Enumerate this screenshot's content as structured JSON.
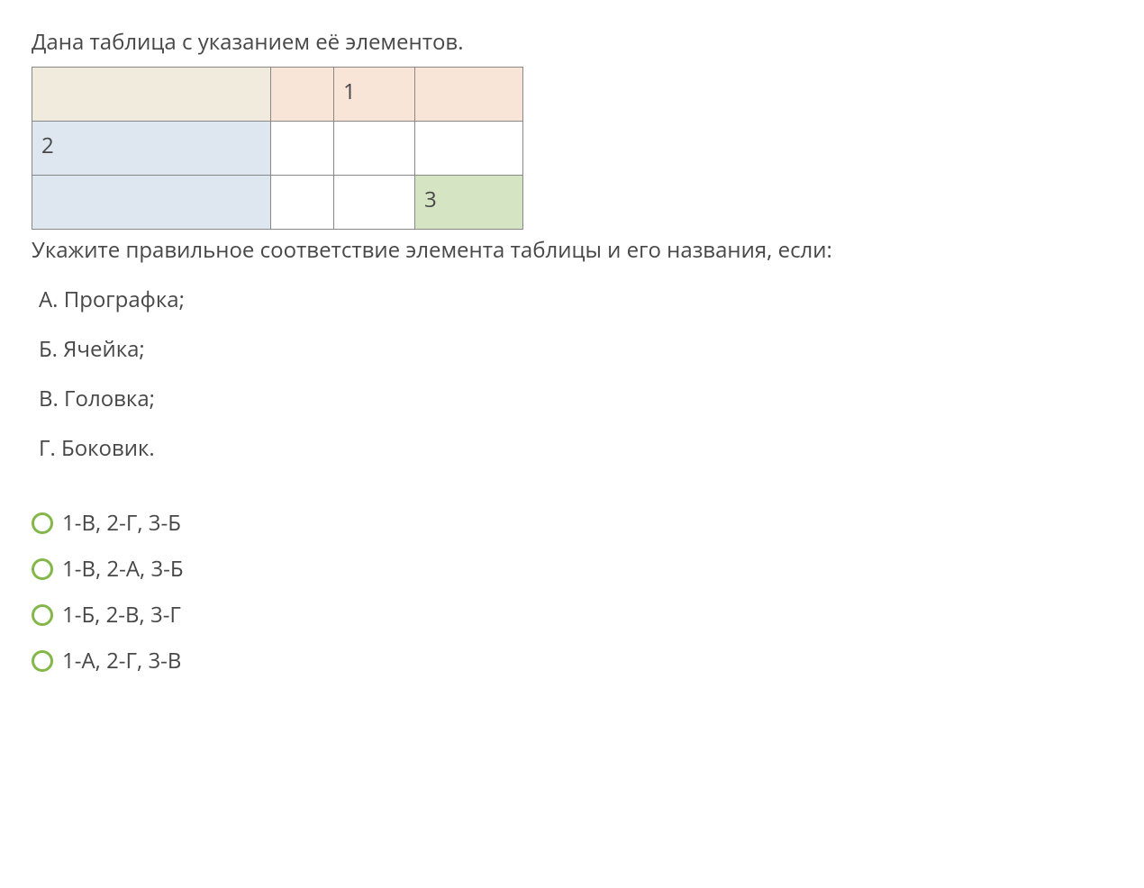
{
  "question_intro": "Дана таблица с указанием её элементов.",
  "table": {
    "cells": {
      "r1c3": "1",
      "r2c1": "2",
      "r3c4": "3"
    }
  },
  "instruction": "Укажите правильное соответствие элемента таблицы и его названия, если:",
  "definitions": [
    "А. Прографка;",
    "Б. Ячейка;",
    "В. Головка;",
    "Г. Боковик."
  ],
  "options": [
    "1-В, 2-Г, 3-Б",
    "1-В, 2-А, 3-Б",
    "1-Б, 2-В, 3-Г",
    "1-А, 2-Г, 3-В"
  ]
}
